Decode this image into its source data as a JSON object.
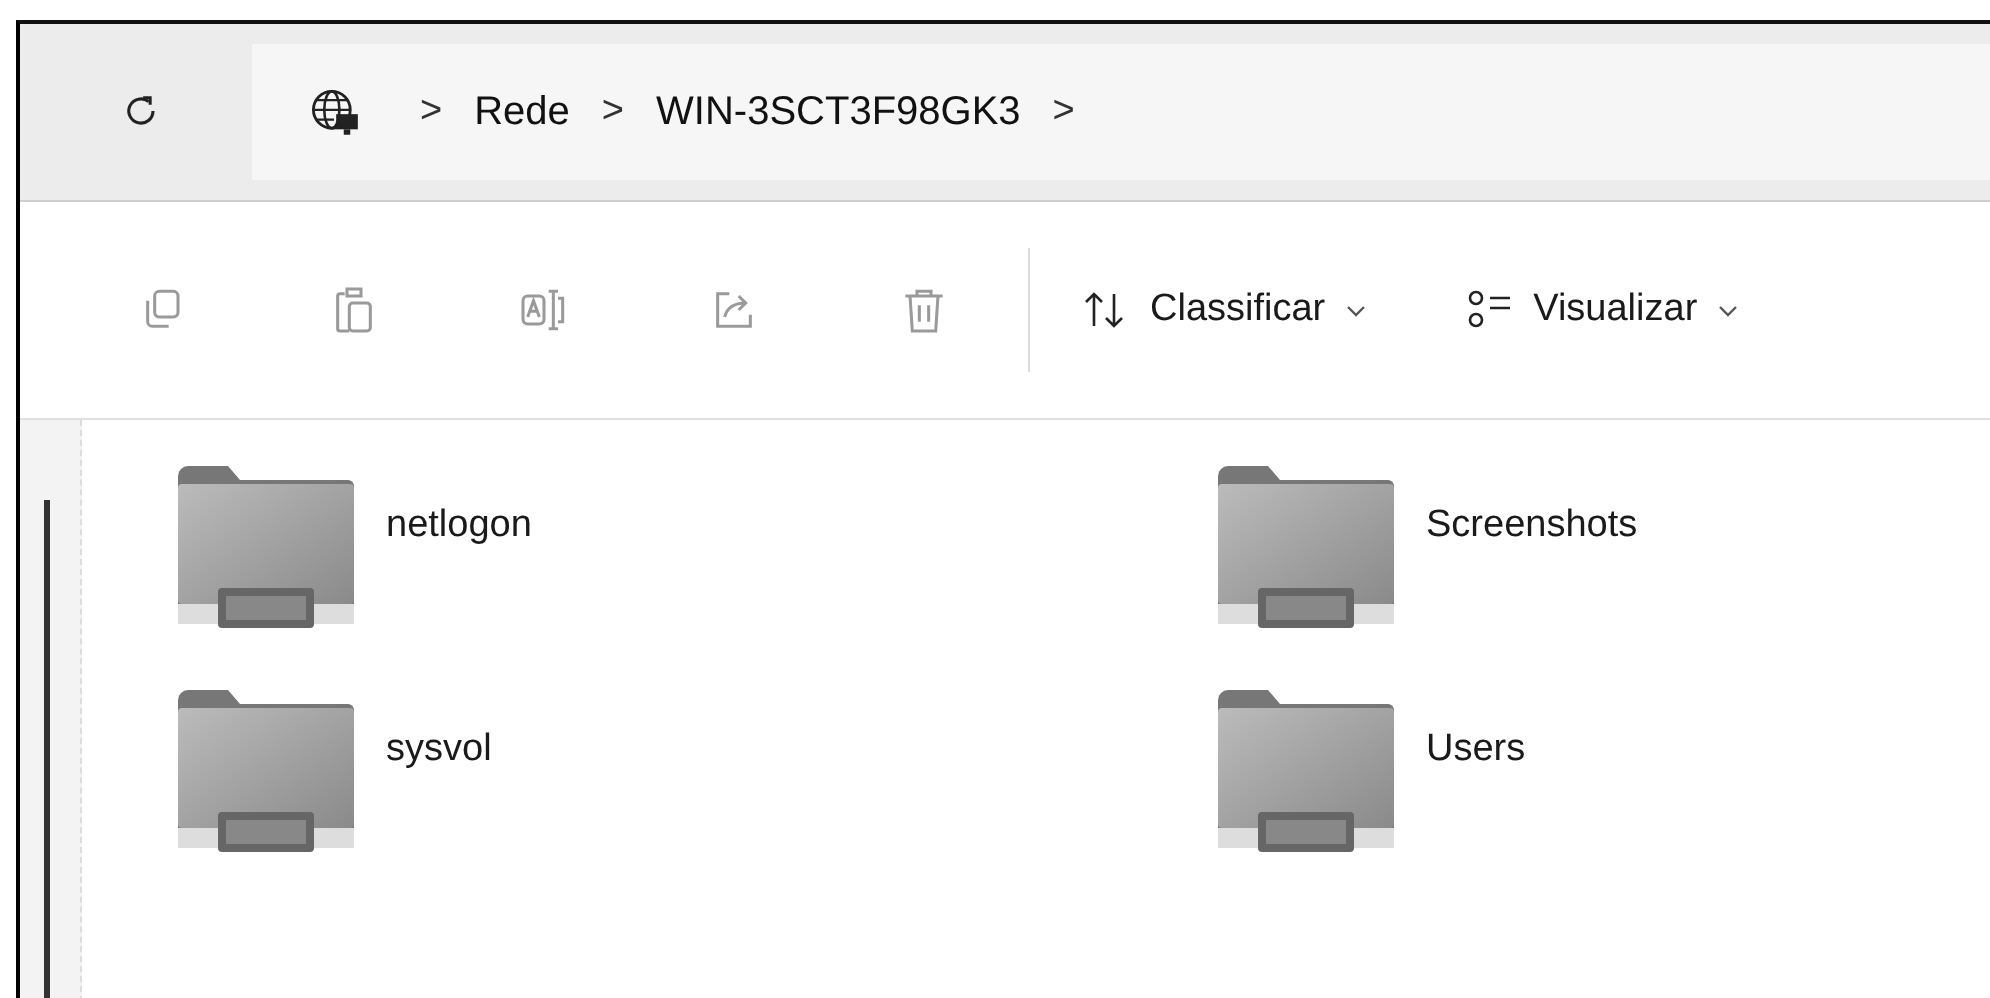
{
  "address_bar": {
    "breadcrumbs": [
      {
        "label": "Rede"
      },
      {
        "label": "WIN-3SCT3F98GK3"
      }
    ],
    "separator": ">"
  },
  "toolbar": {
    "icon_buttons": [
      {
        "kind": "copy",
        "disabled": true
      },
      {
        "kind": "paste",
        "disabled": true
      },
      {
        "kind": "rename",
        "disabled": true
      },
      {
        "kind": "share",
        "disabled": true
      },
      {
        "kind": "delete",
        "disabled": true
      }
    ],
    "menus": [
      {
        "kind": "sort",
        "label": "Classificar"
      },
      {
        "kind": "view",
        "label": "Visualizar"
      }
    ]
  },
  "folders": [
    {
      "name": "netlogon"
    },
    {
      "name": "Screenshots"
    },
    {
      "name": "sysvol"
    },
    {
      "name": "Users"
    }
  ]
}
